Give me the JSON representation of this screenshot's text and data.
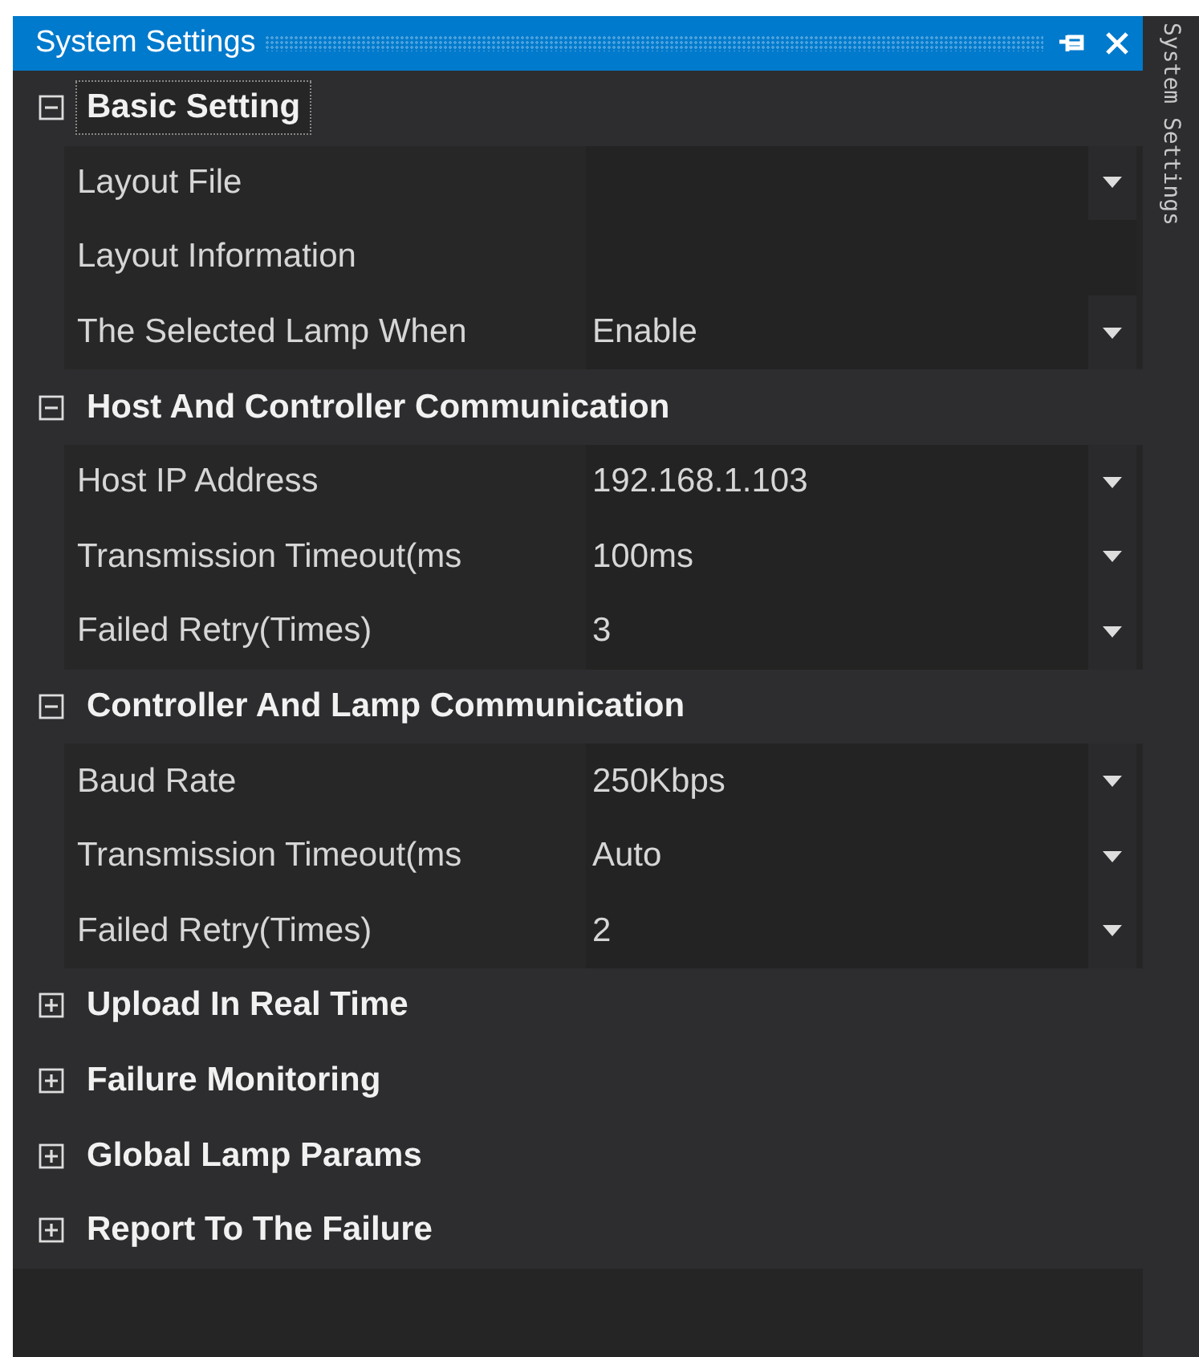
{
  "window": {
    "title": "System Settings"
  },
  "side_tab": {
    "label": "System Settings"
  },
  "categories": [
    {
      "label": "Basic Setting",
      "expanded": true,
      "selected": true,
      "properties": [
        {
          "name": "Layout File",
          "kind": "dropdown"
        },
        {
          "name": "Layout Information",
          "kind": "text"
        },
        {
          "name": "The Selected Lamp When",
          "value": "Enable",
          "kind": "dropdown"
        }
      ]
    },
    {
      "label": "Host And Controller Communication",
      "expanded": true,
      "selected": false,
      "properties": [
        {
          "name": "Host IP Address",
          "value": "192.168.1.103",
          "kind": "dropdown"
        },
        {
          "name": "Transmission Timeout(ms",
          "value": "100ms",
          "kind": "dropdown"
        },
        {
          "name": "Failed Retry(Times)",
          "value": "3",
          "kind": "dropdown"
        }
      ]
    },
    {
      "label": "Controller And Lamp Communication",
      "expanded": true,
      "selected": false,
      "properties": [
        {
          "name": "Baud Rate",
          "value": "250Kbps",
          "kind": "dropdown"
        },
        {
          "name": "Transmission Timeout(ms",
          "value": "Auto",
          "kind": "dropdown"
        },
        {
          "name": "Failed Retry(Times)",
          "value": "2",
          "kind": "dropdown"
        }
      ]
    },
    {
      "label": "Upload In Real Time",
      "expanded": false,
      "selected": false
    },
    {
      "label": "Failure Monitoring",
      "expanded": false,
      "selected": false
    },
    {
      "label": "Global Lamp Params",
      "expanded": false,
      "selected": false
    },
    {
      "label": "Report To The Failure",
      "expanded": false,
      "selected": false
    }
  ]
}
